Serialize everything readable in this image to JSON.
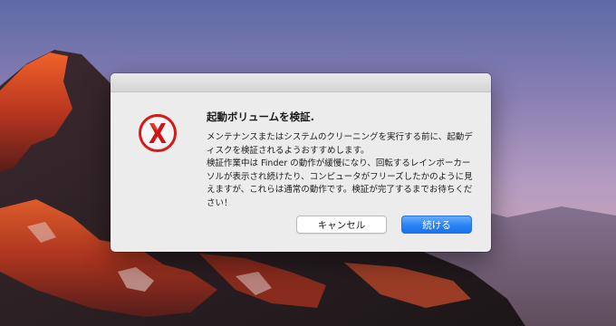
{
  "dialog": {
    "heading": "起動ボリュームを検証.",
    "paragraphs": [
      "メンテナンスまたはシステムのクリーニングを実行する前に、起動ディスクを検証されるようおすすめします。",
      "検証作業中は Finder の動作が緩慢になり、回転するレインボーカーソルが表示され続けたり、コンピュータがフリーズしたかのように見えますが、これらは通常の動作です。検証が完了するまでお待ちください！"
    ],
    "buttons": {
      "cancel_label": "キャンセル",
      "continue_label": "続ける"
    },
    "icon": "onyx-x-icon"
  },
  "colors": {
    "accent": "#2a82f6",
    "icon_red": "#d41c1c"
  }
}
